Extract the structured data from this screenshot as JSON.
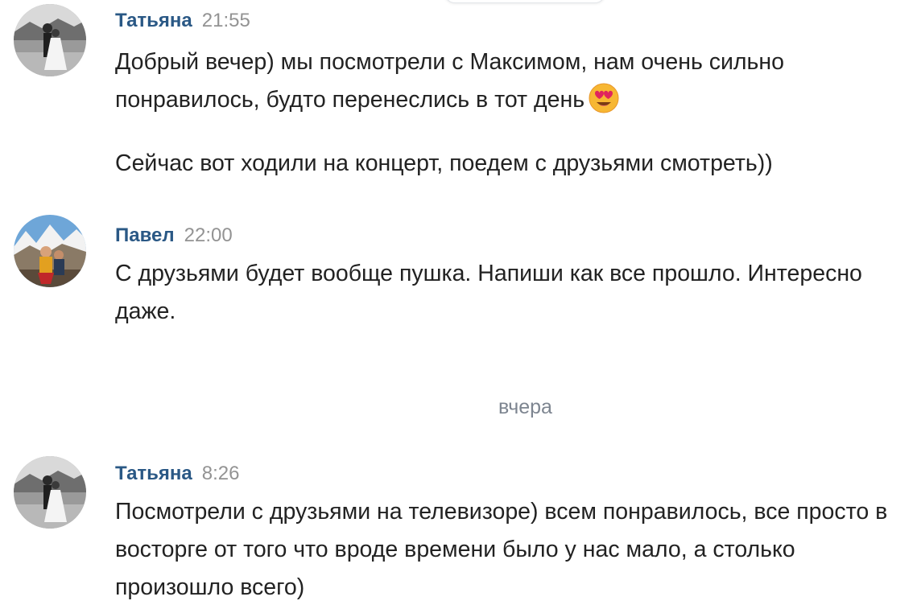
{
  "messages": [
    {
      "author": "Татьяна",
      "time": "21:55",
      "line1": "Добрый вечер) мы посмотрели с Максимом, нам очень сильно понравилось, будто перенеслись в тот день",
      "emoji": "heart-eyes-emoji",
      "line2": "Сейчас вот ходили на концерт, поедем с друзьями смотреть))"
    },
    {
      "author": "Павел",
      "time": "22:00",
      "text": "С друзьями будет вообще пушка. Напиши как все прошло. Интересно даже."
    },
    {
      "author": "Татьяна",
      "time": "8:26",
      "text": "Посмотрели с друзьями на телевизоре) всем понравилось, все просто в восторге от того что вроде времени было у нас мало, а столько произошло всего)"
    }
  ],
  "date_separator": "вчера",
  "colors": {
    "author": "#2a5885",
    "time": "#939393",
    "text": "#222222",
    "separator": "#7d8590"
  }
}
